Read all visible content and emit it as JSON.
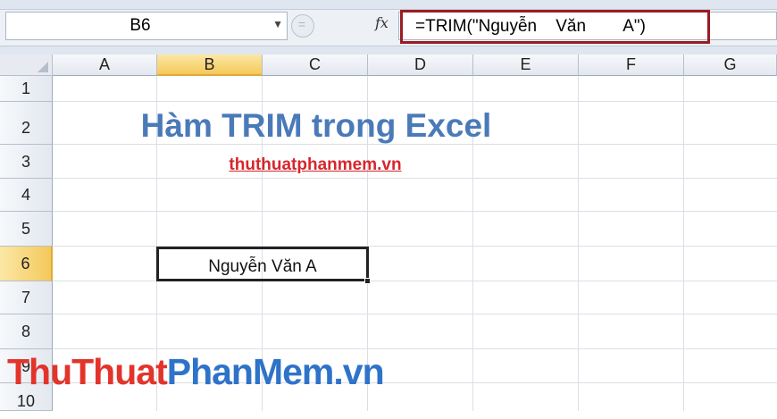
{
  "formula_bar": {
    "name_box": "B6",
    "fx_label": "fx",
    "formula": "=TRIM(\"Nguyễn    Văn        A\")"
  },
  "columns": [
    "A",
    "B",
    "C",
    "D",
    "E",
    "F",
    "G"
  ],
  "rows": [
    "1",
    "2",
    "3",
    "4",
    "5",
    "6",
    "7",
    "8",
    "9",
    "10"
  ],
  "selected": {
    "column": "B",
    "row": "6"
  },
  "cells": {
    "title": "Hàm TRIM trong Excel",
    "site_link": "thuthuatphanmem.vn",
    "B6": "Nguyễn Văn A"
  },
  "watermark": {
    "part1": "ThuThuat",
    "part2": "PhanMem.vn"
  },
  "colors": {
    "title": "#4a7ab8",
    "link": "#d6262c",
    "highlight_border": "#9a1c24",
    "selection": "#f5c95a"
  }
}
